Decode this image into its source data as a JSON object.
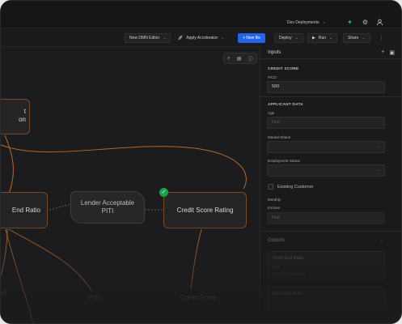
{
  "topbar": {
    "environment": "Dev Deployments"
  },
  "toolbar": {
    "editor_select": "New DMN Editor",
    "accelerator": "Apply Accelerator",
    "new_file": "+ New file",
    "deploy": "Deploy",
    "run": "Run",
    "share": "Share"
  },
  "canvas": {
    "nodes": {
      "top_left_line1": "t",
      "top_left_line2": "on",
      "end_ratio": "End Ratio",
      "lender_piti": "Lender Acceptable PITI",
      "credit_score_rating": "Credit Score Rating"
    },
    "inputs": {
      "left_line1": "ed",
      "left_line2": "t",
      "piti": "PITI",
      "credit_score": "Credit Score"
    }
  },
  "panel": {
    "title": "Inputs",
    "credit_score_section": "CREDIT SCORE",
    "fico_label": "FICO",
    "fico_value": "500",
    "applicant_section": "APPLICANT DATA",
    "age_label": "Age",
    "age_placeholder": "Null",
    "marital_label": "Marital Status",
    "employment_label": "Employment Status",
    "existing_customer": "Existing Customer",
    "monthly_label": "Monthly",
    "income_label": "Income",
    "income_placeholder": "Null",
    "outputs_label": "Outputs",
    "output1_title": "Front End Ratio",
    "output1_value": "Null",
    "output1_note": "0 : 0 ms (evaluated)",
    "output2_title": "Back End Ratio"
  },
  "colors": {
    "accent": "#2563eb",
    "decision_border": "#7a4a22",
    "edge": "#c87a35",
    "success": "#16a34a"
  }
}
